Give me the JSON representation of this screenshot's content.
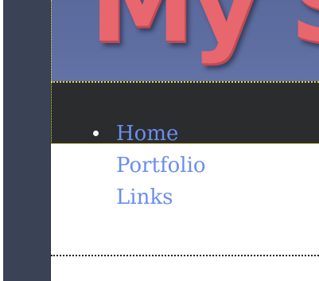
{
  "header": {
    "banner_title": "My S"
  },
  "nav": {
    "items": [
      {
        "label": "Home"
      },
      {
        "label": "Portfolio"
      },
      {
        "label": "Links"
      }
    ]
  },
  "colors": {
    "sidebar": "#3a4255",
    "banner": "#5e6ea1",
    "title": "#e8666e",
    "nav_bar": "#2b2c2e",
    "link": "#6b8dee",
    "dotted_border": "#e6d64a"
  }
}
